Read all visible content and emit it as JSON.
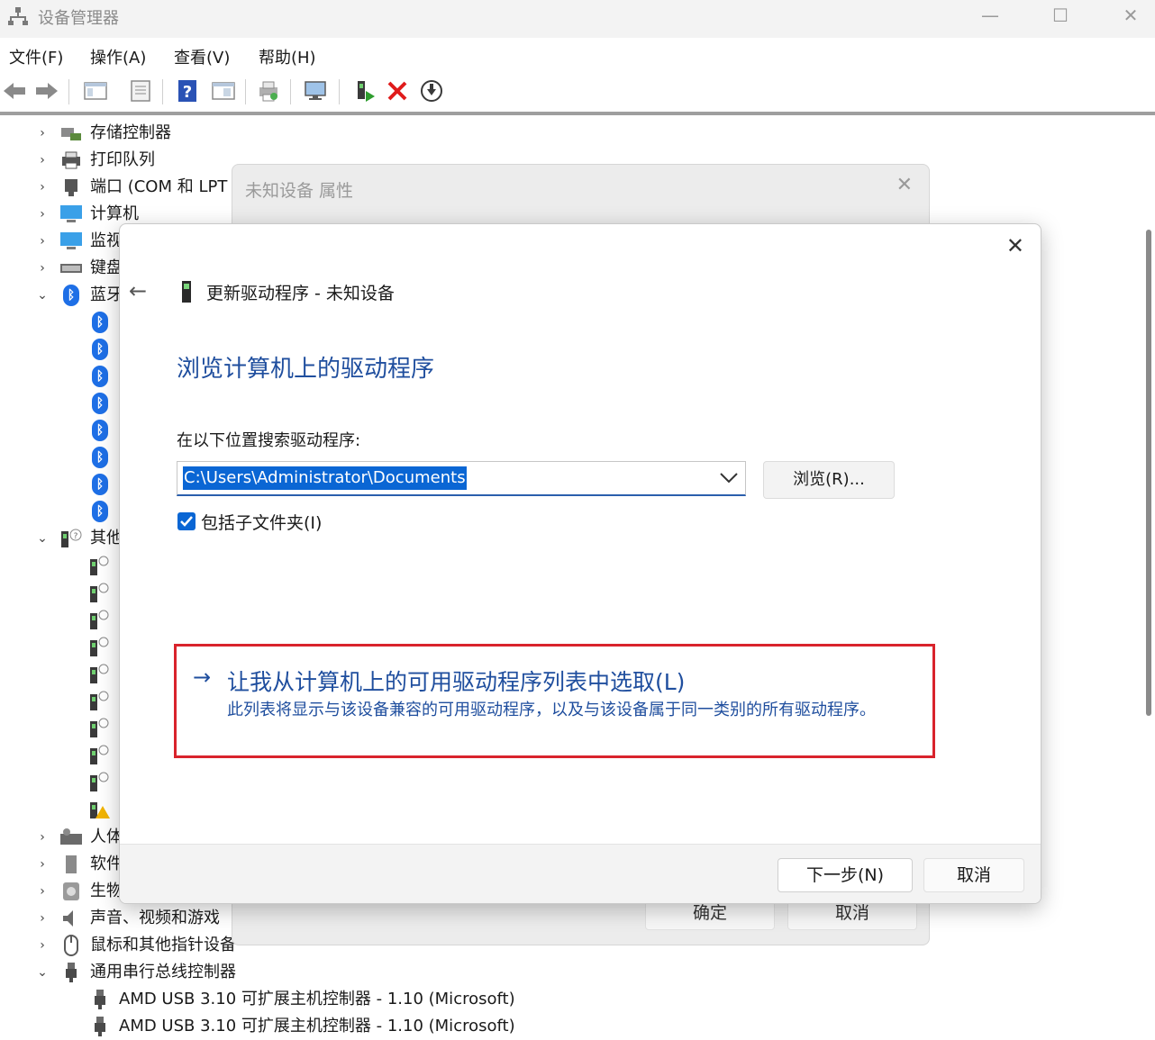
{
  "window": {
    "title": "设备管理器",
    "minimize": "—",
    "maximize": "☐",
    "close": "✕"
  },
  "menu": [
    "文件(F)",
    "操作(A)",
    "查看(V)",
    "帮助(H)"
  ],
  "tree": {
    "categories": [
      {
        "label": "存储控制器",
        "icon": "storage-controller-icon",
        "expanded": false
      },
      {
        "label": "打印队列",
        "icon": "printer-icon",
        "expanded": false
      },
      {
        "label": "端口 (COM 和 LPT",
        "icon": "port-icon",
        "expanded": false
      },
      {
        "label": "计算机",
        "icon": "computer-icon",
        "expanded": false
      },
      {
        "label": "监视",
        "icon": "monitor-icon",
        "expanded": false
      },
      {
        "label": "键盘",
        "icon": "keyboard-icon",
        "expanded": false
      },
      {
        "label": "蓝牙",
        "icon": "bluetooth-icon",
        "expanded": true
      },
      {
        "label": "其他",
        "icon": "unknown-device-icon",
        "expanded": true
      },
      {
        "label": "人体",
        "icon": "hid-icon",
        "expanded": false
      },
      {
        "label": "软件",
        "icon": "software-device-icon",
        "expanded": false
      },
      {
        "label": "生物",
        "icon": "biometric-icon",
        "expanded": false
      },
      {
        "label": "声音、视频和游戏",
        "icon": "speaker-icon",
        "expanded": false
      },
      {
        "label": "鼠标和其他指针设备",
        "icon": "mouse-icon",
        "expanded": false
      },
      {
        "label": "通用串行总线控制器",
        "icon": "usb-icon",
        "expanded": true
      }
    ],
    "usb_items": [
      "AMD USB 3.10 可扩展主机控制器 - 1.10 (Microsoft)",
      "AMD USB 3.10 可扩展主机控制器 - 1.10 (Microsoft)"
    ],
    "bluetooth_child_count": 8,
    "other_child_count": 10
  },
  "properties_dialog": {
    "title": "未知设备 属性",
    "close": "✕",
    "ok_label": "确定",
    "cancel_label": "取消"
  },
  "update_dialog": {
    "close": "✕",
    "back": "←",
    "header": "更新驱动程序 - 未知设备",
    "heading": "浏览计算机上的驱动程序",
    "search_label": "在以下位置搜索驱动程序:",
    "path_value": "C:\\Users\\Administrator\\Documents",
    "browse_label": "浏览(R)...",
    "include_subfolders_label": "包括子文件夹(I)",
    "include_subfolders_checked": true,
    "pick_arrow": "→",
    "pick_title": "让我从计算机上的可用驱动程序列表中选取(L)",
    "pick_desc": "此列表将显示与该设备兼容的可用驱动程序，以及与该设备属于同一类别的所有驱动程序。",
    "next_label": "下一步(N)",
    "cancel_label": "取消"
  },
  "colors": {
    "accent": "#0a66d4",
    "link_blue": "#1f4e9e",
    "highlight_red": "#d9232c"
  }
}
